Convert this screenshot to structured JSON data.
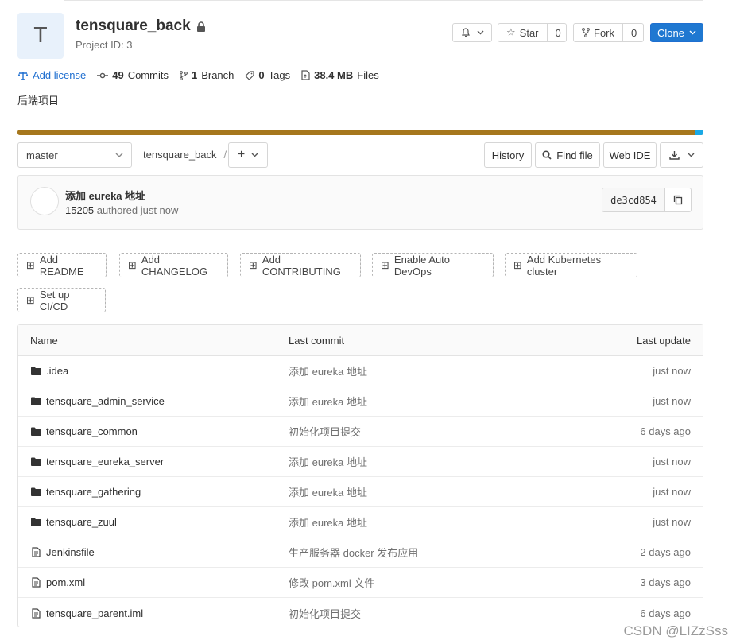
{
  "project": {
    "avatar_letter": "T",
    "name": "tensquare_back",
    "id_text": "Project ID: 3",
    "visibility": "lock-icon"
  },
  "actions": {
    "star_label": "Star",
    "star_count": "0",
    "fork_label": "Fork",
    "fork_count": "0",
    "clone_label": "Clone"
  },
  "stats": {
    "license_label": "Add license",
    "commits_count": "49",
    "commits_label": "Commits",
    "branch_count": "1",
    "branch_label": "Branch",
    "tags_count": "0",
    "tags_label": "Tags",
    "files_size": "38.4 MB",
    "files_label": "Files"
  },
  "description": "后端项目",
  "language_bar": {
    "primary_color": "#a6771d",
    "secondary_color": "#1aa9e6"
  },
  "toolbar": {
    "branch": "master",
    "breadcrumb_root": "tensquare_back",
    "breadcrumb_sep": "/",
    "history_label": "History",
    "find_file_label": "Find file",
    "web_ide_label": "Web IDE"
  },
  "last_commit": {
    "title": "添加 eureka 地址",
    "author": "15205",
    "meta": "authored just now",
    "sha": "de3cd854"
  },
  "quick_actions": [
    "Add README",
    "Add CHANGELOG",
    "Add CONTRIBUTING",
    "Enable Auto DevOps",
    "Add Kubernetes cluster",
    "Set up CI/CD"
  ],
  "files_table": {
    "headers": {
      "name": "Name",
      "last_commit": "Last commit",
      "last_update": "Last update"
    },
    "rows": [
      {
        "type": "folder",
        "name": ".idea",
        "commit": "添加 eureka 地址",
        "updated": "just now"
      },
      {
        "type": "folder",
        "name": "tensquare_admin_service",
        "commit": "添加 eureka 地址",
        "updated": "just now"
      },
      {
        "type": "folder",
        "name": "tensquare_common",
        "commit": "初始化项目提交",
        "updated": "6 days ago"
      },
      {
        "type": "folder",
        "name": "tensquare_eureka_server",
        "commit": "添加 eureka 地址",
        "updated": "just now"
      },
      {
        "type": "folder",
        "name": "tensquare_gathering",
        "commit": "添加 eureka 地址",
        "updated": "just now"
      },
      {
        "type": "folder",
        "name": "tensquare_zuul",
        "commit": "添加 eureka 地址",
        "updated": "just now"
      },
      {
        "type": "file",
        "name": "Jenkinsfile",
        "commit": "生产服务器 docker 发布应用",
        "updated": "2 days ago"
      },
      {
        "type": "file",
        "name": "pom.xml",
        "commit": "修改 pom.xml 文件",
        "updated": "3 days ago"
      },
      {
        "type": "file",
        "name": "tensquare_parent.iml",
        "commit": "初始化项目提交",
        "updated": "6 days ago"
      }
    ]
  },
  "watermark": "CSDN @LIZzSss"
}
